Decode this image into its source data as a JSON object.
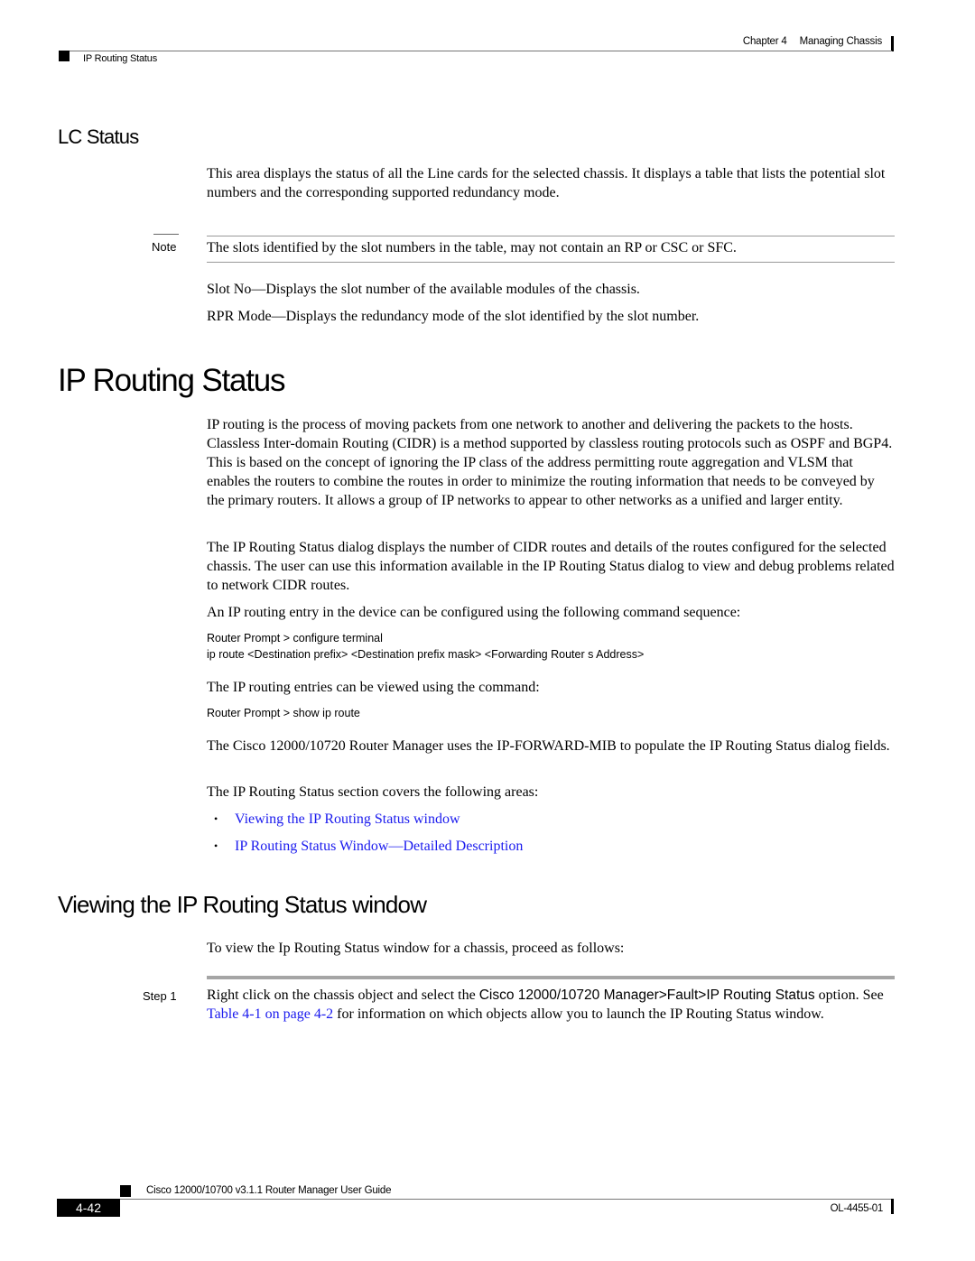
{
  "header": {
    "chapter_label": "Chapter 4",
    "chapter_title": "Managing Chassis",
    "section_title": "IP Routing Status"
  },
  "lc_status": {
    "heading": "LC Status",
    "intro": "This area displays the status of all the Line cards for the selected chassis. It displays a table that lists the potential slot numbers and the corresponding supported redundancy mode.",
    "note_label": "Note",
    "note_text": "The slots identified by the slot numbers in the table, may not contain an RP or CSC or SFC.",
    "fields": [
      "Slot No—Displays the slot number of the available modules of the chassis.",
      "RPR Mode—Displays the redundancy mode of the slot identified by the slot number."
    ]
  },
  "ip_routing": {
    "heading": "IP Routing Status",
    "para1": "IP routing is the process of moving packets from one network to another and delivering the packets to the hosts. Classless Inter-domain Routing (CIDR) is a method supported by classless routing protocols such as OSPF and BGP4. This is based on the concept of ignoring the IP class of the address permitting route aggregation and VLSM that enables the routers to combine the routes in order to minimize the routing information that needs to be conveyed by the primary routers. It allows a group of IP networks to appear to other networks as a unified and larger entity.",
    "para2": "The IP Routing Status dialog displays the number of CIDR routes and details of the routes configured for the selected chassis. The user can use this information available in the IP Routing Status dialog to view and debug problems related to network CIDR routes.",
    "para3": "An IP routing entry in the device can be configured using the following command sequence:",
    "cmd1": "Router Prompt > configure terminal",
    "cmd2": "ip route <Destination prefix> <Destination prefix mask> <Forwarding Router s Address>",
    "para4": "The IP routing entries can be viewed using the command:",
    "cmd3": "Router Prompt > show ip route",
    "para5": "The Cisco 12000/10720 Router Manager uses the IP-FORWARD-MIB to populate the IP Routing Status dialog fields.",
    "para6": "The IP Routing Status section covers the following areas:",
    "bullet_char": "•",
    "links": [
      "Viewing the IP Routing Status window",
      "IP Routing Status Window—Detailed Description"
    ],
    "link_color": "#1a1aee"
  },
  "viewing": {
    "heading": "Viewing the IP Routing Status window",
    "intro": "To view the Ip Routing Status window for a chassis, proceed as follows:",
    "step_label": "Step 1",
    "step_text_a": "Right click on the chassis object and select the ",
    "step_menu_path": "Cisco 12000/10720 Manager>Fault>IP Routing Status",
    "step_text_b": " option. See ",
    "step_link": "Table 4-1 on page 4-2",
    "step_text_c": " for information on which objects allow you to launch the IP Routing Status window."
  },
  "footer": {
    "guide_title": "Cisco 12000/10700 v3.1.1 Router Manager User Guide",
    "page_number": "4-42",
    "doc_number": "OL-4455-01"
  }
}
